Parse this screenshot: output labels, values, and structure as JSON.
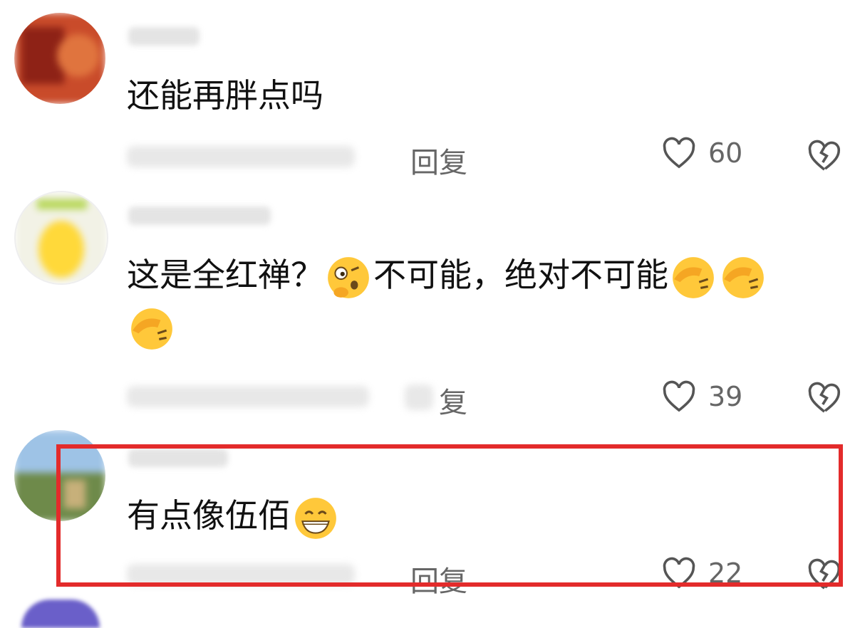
{
  "comments": [
    {
      "text": "还能再胖点吗",
      "reply_label": "回复",
      "like_count": "60",
      "avatar": "blurred-red-avatar",
      "highlighted": false
    },
    {
      "text_parts": [
        "这是全红禅？",
        "不可能，绝对不可能"
      ],
      "emojis": [
        "thinking-face-emoji",
        "facepalm-emoji",
        "facepalm-emoji",
        "facepalm-emoji"
      ],
      "reply_label": "复",
      "like_count": "39",
      "avatar": "blurred-cartoon-avatar",
      "highlighted": false
    },
    {
      "text": "有点像伍佰",
      "emojis": [
        "grinning-face-emoji"
      ],
      "reply_label": "回复",
      "like_count": "22",
      "avatar": "blurred-landscape-avatar",
      "highlighted": true
    }
  ],
  "colors": {
    "highlight_border": "#e32b2b",
    "emoji_yellow": "#ffc83a",
    "meta_gray": "#666666"
  },
  "icons": {
    "like": "heart-outline-icon",
    "dislike": "broken-heart-icon"
  }
}
